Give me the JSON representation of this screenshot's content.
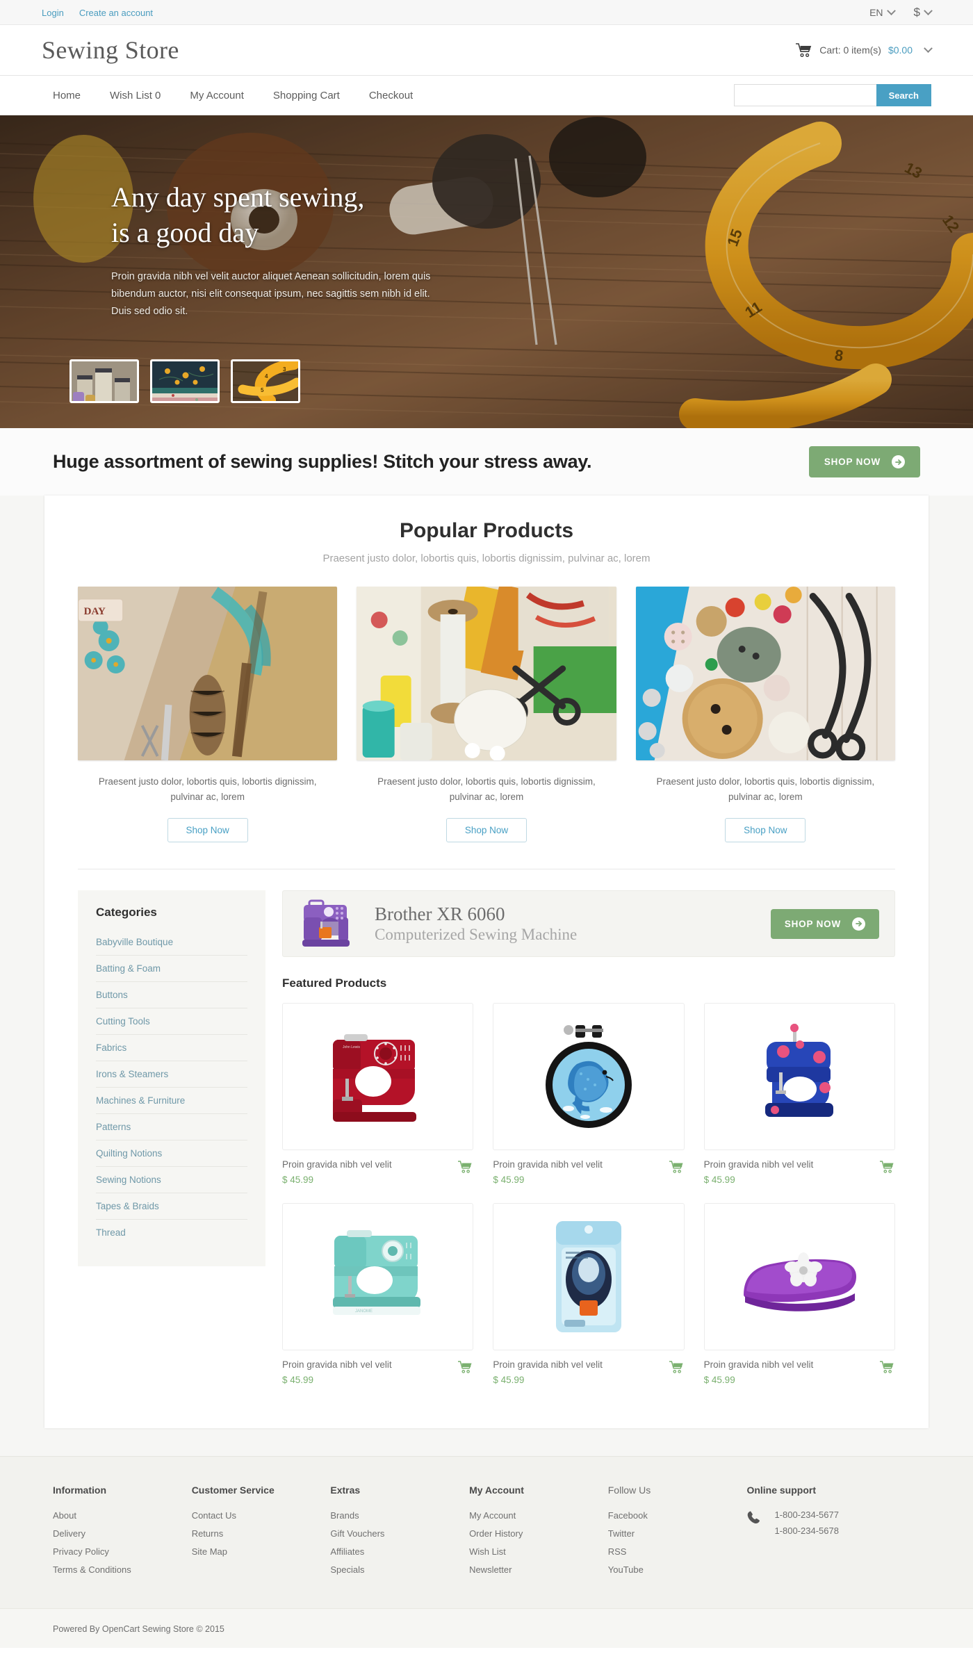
{
  "topbar": {
    "login": "Login",
    "create_account": "Create an account",
    "language": "EN",
    "currency": "$"
  },
  "header": {
    "logo": "Sewing Store",
    "cart_label": "Cart: 0 item(s)",
    "cart_total": "$0.00"
  },
  "nav": {
    "items": [
      {
        "label": "Home"
      },
      {
        "label": "Wish List 0"
      },
      {
        "label": "My Account"
      },
      {
        "label": "Shopping Cart"
      },
      {
        "label": "Checkout"
      }
    ],
    "search_placeholder": "",
    "search_value": "",
    "search_button": "Search"
  },
  "hero": {
    "title_line1": "Any day spent sewing,",
    "title_line2": "is a good day",
    "description": "Proin gravida nibh vel velit auctor aliquet Aenean sollicitudin, lorem quis bibendum auctor, nisi elit consequat ipsum, nec sagittis sem nibh id elit. Duis sed odio sit.",
    "thumbs": [
      {
        "name": "thread-spools-thumb"
      },
      {
        "name": "folded-fabrics-thumb"
      },
      {
        "name": "tape-measure-thumb"
      }
    ]
  },
  "cta": {
    "headline": "Huge assortment of sewing supplies! Stitch your stress away.",
    "button": "SHOP NOW"
  },
  "popular": {
    "title": "Popular Products",
    "subtitle": "Praesent justo dolor, lobortis quis, lobortis dignissim, pulvinar ac, lorem",
    "items": [
      {
        "caption": "Praesent justo dolor, lobortis quis, lobortis dignissim, pulvinar ac, lorem",
        "button": "Shop Now",
        "image_name": "craft-supplies-photo"
      },
      {
        "caption": "Praesent justo dolor, lobortis quis, lobortis dignissim, pulvinar ac, lorem",
        "button": "Shop Now",
        "image_name": "thread-spool-scissors-photo"
      },
      {
        "caption": "Praesent justo dolor, lobortis quis, lobortis dignissim, pulvinar ac, lorem",
        "button": "Shop Now",
        "image_name": "buttons-scissors-photo"
      }
    ]
  },
  "categories": {
    "title": "Categories",
    "items": [
      {
        "label": "Babyville Boutique"
      },
      {
        "label": "Batting & Foam"
      },
      {
        "label": "Buttons"
      },
      {
        "label": "Cutting Tools"
      },
      {
        "label": "Fabrics"
      },
      {
        "label": "Irons & Steamers"
      },
      {
        "label": "Machines & Furniture"
      },
      {
        "label": "Patterns"
      },
      {
        "label": "Quilting Notions"
      },
      {
        "label": "Sewing Notions"
      },
      {
        "label": "Tapes & Braids"
      },
      {
        "label": "Thread"
      }
    ]
  },
  "promo": {
    "title": "Brother XR 6060",
    "subtitle": "Computerized Sewing Machine",
    "button": "SHOP NOW"
  },
  "featured": {
    "title": "Featured Products",
    "items": [
      {
        "name": "Proin gravida nibh vel velit",
        "price": "$ 45.99",
        "image_name": "red-sewing-machine"
      },
      {
        "name": "Proin gravida nibh vel velit",
        "price": "$ 45.99",
        "image_name": "dolphin-embroidery-hoop"
      },
      {
        "name": "Proin gravida nibh vel velit",
        "price": "$ 45.99",
        "image_name": "blue-toy-sewing-machine"
      },
      {
        "name": "Proin gravida nibh vel velit",
        "price": "$ 45.99",
        "image_name": "teal-janome-machine"
      },
      {
        "name": "Proin gravida nibh vel velit",
        "price": "$ 45.99",
        "image_name": "packaged-sewing-gadget"
      },
      {
        "name": "Proin gravida nibh vel velit",
        "price": "$ 45.99",
        "image_name": "purple-flower-punch"
      }
    ]
  },
  "footer": {
    "columns": [
      {
        "title": "Information",
        "links": [
          {
            "label": "About"
          },
          {
            "label": "Delivery"
          },
          {
            "label": "Privacy Policy"
          },
          {
            "label": "Terms & Conditions"
          }
        ]
      },
      {
        "title": "Customer Service",
        "links": [
          {
            "label": "Contact Us"
          },
          {
            "label": "Returns"
          },
          {
            "label": "Site Map"
          }
        ]
      },
      {
        "title": "Extras",
        "links": [
          {
            "label": "Brands"
          },
          {
            "label": "Gift Vouchers"
          },
          {
            "label": "Affiliates"
          },
          {
            "label": "Specials"
          }
        ]
      },
      {
        "title": "My Account",
        "links": [
          {
            "label": "My Account"
          },
          {
            "label": "Order History"
          },
          {
            "label": "Wish List"
          },
          {
            "label": "Newsletter"
          }
        ]
      },
      {
        "title": "Follow Us",
        "links": [
          {
            "label": "Facebook"
          },
          {
            "label": "Twitter"
          },
          {
            "label": "RSS"
          },
          {
            "label": "YouTube"
          }
        ]
      }
    ],
    "support": {
      "title": "Online support",
      "phone1": "1-800-234-5677",
      "phone2": "1-800-234-5678"
    },
    "copyright": "Powered By OpenCart Sewing Store © 2015"
  },
  "colors": {
    "accent_teal": "#49a0c4",
    "accent_green": "#7daa74",
    "price_green": "#7ab06f",
    "link_blue": "#6f98a8",
    "footer_bg": "#f2f2ee"
  }
}
